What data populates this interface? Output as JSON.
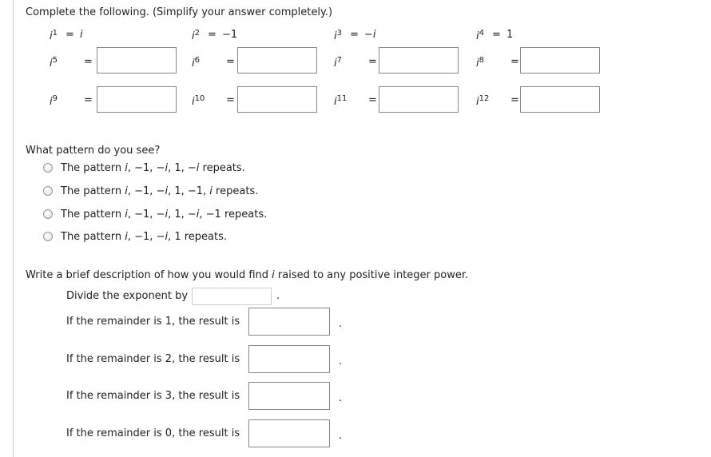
{
  "instruction": "Complete the following. (Simplify your answer completely.)",
  "powers": [
    {
      "exp": "1",
      "value": "i",
      "value_italic": true
    },
    {
      "exp": "2",
      "value": "−1"
    },
    {
      "exp": "3",
      "value": "−i",
      "value_italic": true
    },
    {
      "exp": "4",
      "value": "1"
    },
    {
      "exp": "5",
      "answer": ""
    },
    {
      "exp": "6",
      "answer": ""
    },
    {
      "exp": "7",
      "answer": ""
    },
    {
      "exp": "8",
      "answer": ""
    },
    {
      "exp": "9",
      "answer": ""
    },
    {
      "exp": "10",
      "answer": ""
    },
    {
      "exp": "11",
      "answer": ""
    },
    {
      "exp": "12",
      "answer": ""
    }
  ],
  "base": "i",
  "equals": "=",
  "pattern": {
    "question": "What pattern do you see?",
    "options": [
      [
        [
          "The pattern ",
          0
        ],
        [
          "i",
          1
        ],
        [
          ", −1, ",
          0
        ],
        [
          "−i",
          1
        ],
        [
          ", 1, ",
          0
        ],
        [
          "−i",
          1
        ],
        [
          " repeats.",
          0
        ]
      ],
      [
        [
          "The pattern ",
          0
        ],
        [
          "i",
          1
        ],
        [
          ", −1, ",
          0
        ],
        [
          "−i",
          1
        ],
        [
          ", 1, −1, ",
          0
        ],
        [
          "i",
          1
        ],
        [
          " repeats.",
          0
        ]
      ],
      [
        [
          "The pattern ",
          0
        ],
        [
          "i",
          1
        ],
        [
          ", −1, ",
          0
        ],
        [
          "−i",
          1
        ],
        [
          ", 1, ",
          0
        ],
        [
          "−i",
          1
        ],
        [
          ", −1 repeats.",
          0
        ]
      ],
      [
        [
          "The pattern ",
          0
        ],
        [
          "i",
          1
        ],
        [
          ", −1, ",
          0
        ],
        [
          "−i",
          1
        ],
        [
          ", 1 repeats.",
          0
        ]
      ]
    ],
    "selected": null
  },
  "description": {
    "prompt_before": "Write a brief description of how you would find ",
    "prompt_i": "i",
    "prompt_after": " raised to any positive integer power.",
    "divide_label": "Divide the exponent by",
    "divide_value": "",
    "period": ".",
    "remainders": [
      {
        "label": "If the remainder is 1, the result is",
        "value": ""
      },
      {
        "label": "If the remainder is 2, the result is",
        "value": ""
      },
      {
        "label": "If the remainder is 3, the result is",
        "value": ""
      },
      {
        "label": "If the remainder is 0, the result is",
        "value": ""
      }
    ]
  }
}
